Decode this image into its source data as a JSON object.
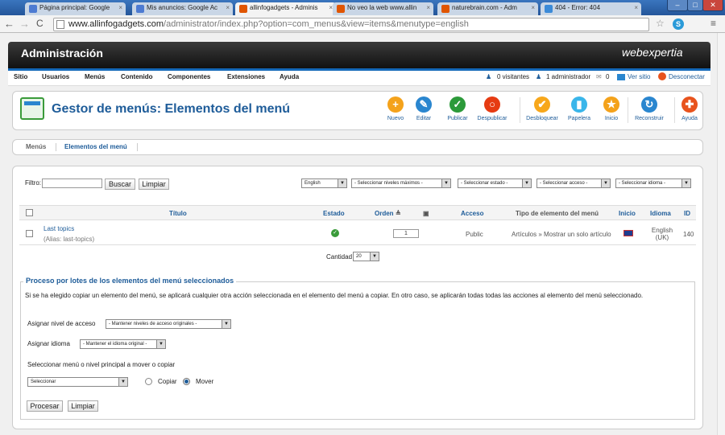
{
  "browser": {
    "tabs": [
      {
        "label": "Página principal: Google",
        "color": "#4d7bd2"
      },
      {
        "label": "Mis anuncios: Google Ac",
        "color": "#4d7bd2"
      },
      {
        "label": "allinfogadgets - Adminis",
        "color": "#e05500"
      },
      {
        "label": "No veo la web www.allin",
        "color": "#e05500"
      },
      {
        "label": "naturebrain.com - Adm",
        "color": "#e05500"
      },
      {
        "label": "404 - Error: 404",
        "color": "#3a8ad8"
      }
    ],
    "url_host": "www.allinfogadgets.com",
    "url_path": "/administrator/index.php?option=com_menus&view=items&menutype=english"
  },
  "header": {
    "title": "Administración",
    "logo": "webexpertia"
  },
  "menu": [
    "Sitio",
    "Usuarios",
    "Menús",
    "Contenido",
    "Componentes",
    "Extensiones",
    "Ayuda"
  ],
  "status": {
    "visitors": "0 visitantes",
    "admins": "1 administrador",
    "messages": "0",
    "view_site": "Ver sitio",
    "logout": "Desconectar"
  },
  "toolbar": {
    "title": "Gestor de menús: Elementos del menú",
    "buttons": [
      {
        "label": "Nuevo",
        "icon": "plus-icon",
        "color": "#f4a21b",
        "glyph": "+"
      },
      {
        "label": "Editar",
        "icon": "pencil-icon",
        "color": "#2a86cf",
        "glyph": "✎"
      },
      {
        "label": "Publicar",
        "icon": "check-icon",
        "color": "#2c9a3a",
        "glyph": "✓"
      },
      {
        "label": "Despublicar",
        "icon": "circle-icon",
        "color": "#e63b12",
        "glyph": "○"
      },
      {
        "label": "Desbloquear",
        "icon": "checkmark-icon",
        "color": "#f7a71b",
        "glyph": "✔"
      },
      {
        "label": "Papelera",
        "icon": "trash-icon",
        "color": "#3ab6ea",
        "glyph": "▮"
      },
      {
        "label": "Inicio",
        "icon": "star-icon",
        "color": "#f4a21b",
        "glyph": "★"
      },
      {
        "label": "Reconstruir",
        "icon": "refresh-icon",
        "color": "#2a86cf",
        "glyph": "↻"
      },
      {
        "label": "Ayuda",
        "icon": "lifebuoy-icon",
        "color": "#e8531d",
        "glyph": "✚"
      }
    ]
  },
  "submenu": [
    "Menús",
    "Elementos del menú"
  ],
  "filter": {
    "label": "Filtro:",
    "search": "Buscar",
    "clear": "Limpiar",
    "selects": [
      "English",
      "- Seleccionar niveles máximos -",
      "- Seleccionar estado -",
      "- Seleccionar acceso -",
      "- Seleccionar idioma -"
    ]
  },
  "table": {
    "headers": [
      "Título",
      "Estado",
      "Orden",
      "Acceso",
      "Tipo de elemento del menú",
      "Inicio",
      "Idioma",
      "ID"
    ],
    "row": {
      "title": "Last topics",
      "alias": "(Alias: last-topics)",
      "order": "1",
      "access": "Public",
      "type": "Artículos » Mostrar un solo artículo",
      "language": "English (UK)",
      "id": "140"
    },
    "limit_label": "Cantidad",
    "limit": "20"
  },
  "batch": {
    "legend": "Proceso por lotes de los elementos del menú seleccionados",
    "tip": "Si se ha elegido copiar un elemento del menú, se aplicará cualquier otra acción seleccionada en el elemento del menú a copiar. En otro caso, se aplicarán todas todas las acciones al elemento del menú seleccionado.",
    "access_label": "Asignar nivel de acceso",
    "access_value": "- Mantener niveles de acceso originales -",
    "lang_label": "Asignar idioma",
    "lang_value": "- Mantener el idioma original -",
    "move_label": "Seleccionar menú o nivel principal a mover o copiar",
    "move_value": "Seleccionar",
    "copy": "Copiar",
    "move": "Mover",
    "process": "Procesar",
    "clear": "Limpiar"
  }
}
